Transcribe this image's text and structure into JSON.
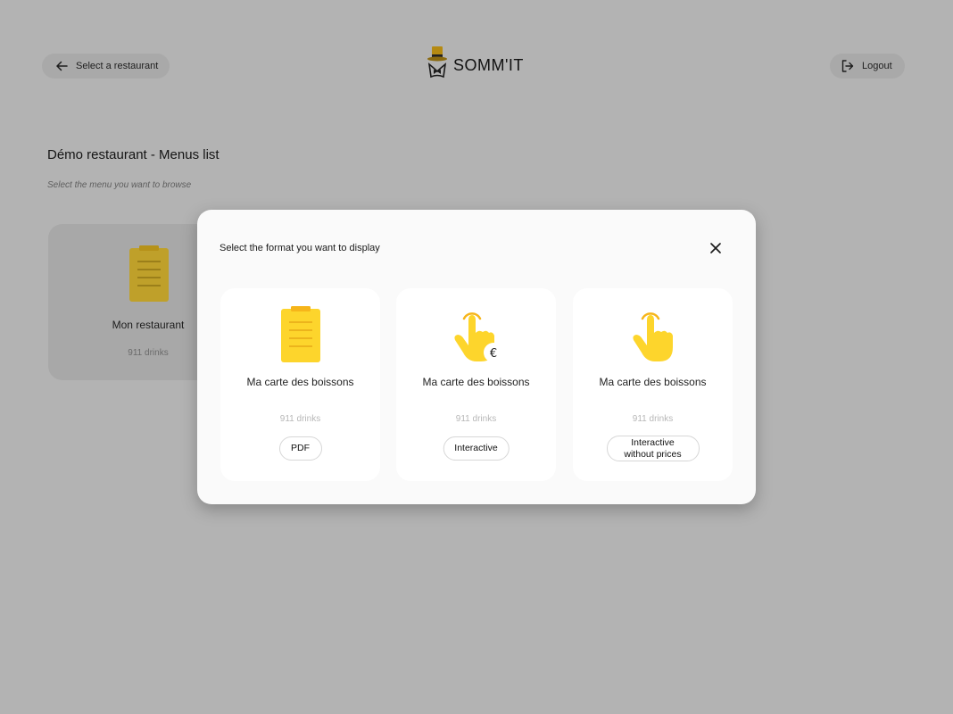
{
  "header": {
    "back_label": "Select a restaurant",
    "logo_text": "SOMM'IT",
    "logout_label": "Logout"
  },
  "page": {
    "title": "Démo restaurant - Menus list",
    "subtitle": "Select the menu you want to browse"
  },
  "menus": [
    {
      "name": "Mon restaurant",
      "count": "911 drinks",
      "icon": "clipboard-icon"
    }
  ],
  "modal": {
    "title": "Select the format you want to display",
    "options": [
      {
        "name": "Ma carte des boissons",
        "count": "911 drinks",
        "button": "PDF",
        "icon": "clipboard-icon"
      },
      {
        "name": "Ma carte des boissons",
        "count": "911 drinks",
        "button": "Interactive",
        "icon": "tap-hand-euro-icon"
      },
      {
        "name": "Ma carte des boissons",
        "count": "911 drinks",
        "button": "Interactive without prices",
        "icon": "tap-hand-icon"
      }
    ]
  },
  "colors": {
    "accent": "#FDD52C",
    "accent_dark": "#F6B51A",
    "backdrop": "#B3B3B3",
    "modal_bg": "#FAFAFA"
  }
}
